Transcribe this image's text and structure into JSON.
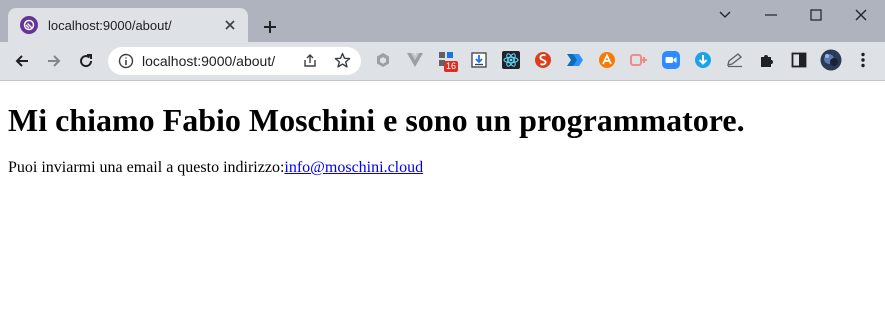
{
  "browser": {
    "tab_title": "localhost:9000/about/",
    "address": "localhost:9000/about/",
    "extension_badge": "16",
    "accent_color": "#663399"
  },
  "page": {
    "heading": "Mi chiamo Fabio Moschini e sono un programmatore.",
    "text_before_link": "Puoi inviarmi una email a questo indirizzo:",
    "email_link": "info@moschini.cloud"
  }
}
